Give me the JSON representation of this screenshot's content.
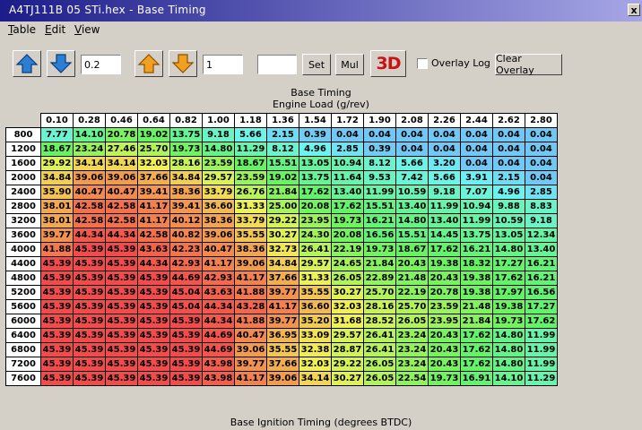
{
  "window": {
    "title": "A4TJ111B 05 STi.hex - Base Timing",
    "close_label": "x"
  },
  "menu": [
    "Table",
    "Edit",
    "View"
  ],
  "toolbar": {
    "step_value": "0.2",
    "mult_value": "1",
    "set_value": "",
    "set_label": "Set",
    "mul_label": "Mul",
    "three_d_label": "3D",
    "overlay_label": "Overlay Log",
    "clear_overlay_label": "Clear Overlay"
  },
  "table": {
    "title": "Base Timing",
    "x_axis_label": "Engine Load (g/rev)",
    "footer_label": "Base Ignition Timing (degrees BTDC)",
    "columns": [
      "0.10",
      "0.28",
      "0.46",
      "0.64",
      "0.82",
      "1.00",
      "1.18",
      "1.36",
      "1.54",
      "1.72",
      "1.90",
      "2.08",
      "2.26",
      "2.44",
      "2.62",
      "2.80"
    ],
    "rows": [
      "800",
      "1200",
      "1600",
      "2000",
      "2400",
      "2800",
      "3200",
      "3600",
      "4000",
      "4400",
      "4800",
      "5200",
      "5600",
      "6000",
      "6400",
      "6800",
      "7200",
      "7600"
    ],
    "cells": [
      [
        "7.77",
        "14.10",
        "20.78",
        "19.02",
        "13.75",
        "9.18",
        "5.66",
        "2.15",
        "0.39",
        "0.04",
        "0.04",
        "0.04",
        "0.04",
        "0.04",
        "0.04",
        "0.04"
      ],
      [
        "18.67",
        "23.24",
        "27.46",
        "25.70",
        "19.73",
        "14.80",
        "11.29",
        "8.12",
        "4.96",
        "2.85",
        "0.39",
        "0.04",
        "0.04",
        "0.04",
        "0.04",
        "0.04"
      ],
      [
        "29.92",
        "34.14",
        "34.14",
        "32.03",
        "28.16",
        "23.59",
        "18.67",
        "15.51",
        "13.05",
        "10.94",
        "8.12",
        "5.66",
        "3.20",
        "0.04",
        "0.04",
        "0.04"
      ],
      [
        "34.84",
        "39.06",
        "39.06",
        "37.66",
        "34.84",
        "29.57",
        "23.59",
        "19.02",
        "13.75",
        "11.64",
        "9.53",
        "7.42",
        "5.66",
        "3.91",
        "2.15",
        "0.04"
      ],
      [
        "35.90",
        "40.47",
        "40.47",
        "39.41",
        "38.36",
        "33.79",
        "26.76",
        "21.84",
        "17.62",
        "13.40",
        "11.99",
        "10.59",
        "9.18",
        "7.07",
        "4.96",
        "2.85"
      ],
      [
        "38.01",
        "42.58",
        "42.58",
        "41.17",
        "39.41",
        "36.60",
        "31.33",
        "25.00",
        "20.08",
        "17.62",
        "15.51",
        "13.40",
        "11.99",
        "10.94",
        "9.88",
        "8.83"
      ],
      [
        "38.01",
        "42.58",
        "42.58",
        "41.17",
        "40.12",
        "38.36",
        "33.79",
        "29.22",
        "23.95",
        "19.73",
        "16.21",
        "14.80",
        "13.40",
        "11.99",
        "10.59",
        "9.18"
      ],
      [
        "39.77",
        "44.34",
        "44.34",
        "42.58",
        "40.82",
        "39.06",
        "35.55",
        "30.27",
        "24.30",
        "20.08",
        "16.56",
        "15.51",
        "14.45",
        "13.75",
        "13.05",
        "12.34"
      ],
      [
        "41.88",
        "45.39",
        "45.39",
        "43.63",
        "42.23",
        "40.47",
        "38.36",
        "32.73",
        "26.41",
        "22.19",
        "19.73",
        "18.67",
        "17.62",
        "16.21",
        "14.80",
        "13.40"
      ],
      [
        "45.39",
        "45.39",
        "45.39",
        "44.34",
        "42.93",
        "41.17",
        "39.06",
        "34.84",
        "29.57",
        "24.65",
        "21.84",
        "20.43",
        "19.38",
        "18.32",
        "17.27",
        "16.21"
      ],
      [
        "45.39",
        "45.39",
        "45.39",
        "45.39",
        "44.69",
        "42.93",
        "41.17",
        "37.66",
        "31.33",
        "26.05",
        "22.89",
        "21.48",
        "20.43",
        "19.38",
        "17.62",
        "16.21"
      ],
      [
        "45.39",
        "45.39",
        "45.39",
        "45.39",
        "45.04",
        "43.63",
        "41.88",
        "39.77",
        "35.55",
        "30.27",
        "25.70",
        "22.19",
        "20.78",
        "19.38",
        "17.97",
        "16.56"
      ],
      [
        "45.39",
        "45.39",
        "45.39",
        "45.39",
        "45.04",
        "44.34",
        "43.28",
        "41.17",
        "36.60",
        "32.03",
        "28.16",
        "25.70",
        "23.59",
        "21.48",
        "19.38",
        "17.27"
      ],
      [
        "45.39",
        "45.39",
        "45.39",
        "45.39",
        "45.39",
        "44.34",
        "41.88",
        "39.77",
        "35.20",
        "31.68",
        "28.52",
        "26.05",
        "23.95",
        "21.84",
        "19.73",
        "17.62"
      ],
      [
        "45.39",
        "45.39",
        "45.39",
        "45.39",
        "45.39",
        "44.69",
        "40.47",
        "36.95",
        "33.09",
        "29.57",
        "26.41",
        "23.24",
        "20.43",
        "17.62",
        "14.80",
        "11.99"
      ],
      [
        "45.39",
        "45.39",
        "45.39",
        "45.39",
        "45.39",
        "44.69",
        "39.06",
        "35.55",
        "32.38",
        "28.87",
        "26.41",
        "23.24",
        "20.43",
        "17.62",
        "14.80",
        "11.99"
      ],
      [
        "45.39",
        "45.39",
        "45.39",
        "45.39",
        "45.39",
        "43.98",
        "39.77",
        "37.66",
        "32.03",
        "29.22",
        "26.05",
        "23.24",
        "20.43",
        "17.62",
        "14.80",
        "11.99"
      ],
      [
        "45.39",
        "45.39",
        "45.39",
        "45.39",
        "45.39",
        "43.98",
        "41.17",
        "39.06",
        "34.14",
        "30.27",
        "26.05",
        "22.54",
        "19.73",
        "16.91",
        "14.10",
        "11.29"
      ]
    ]
  }
}
